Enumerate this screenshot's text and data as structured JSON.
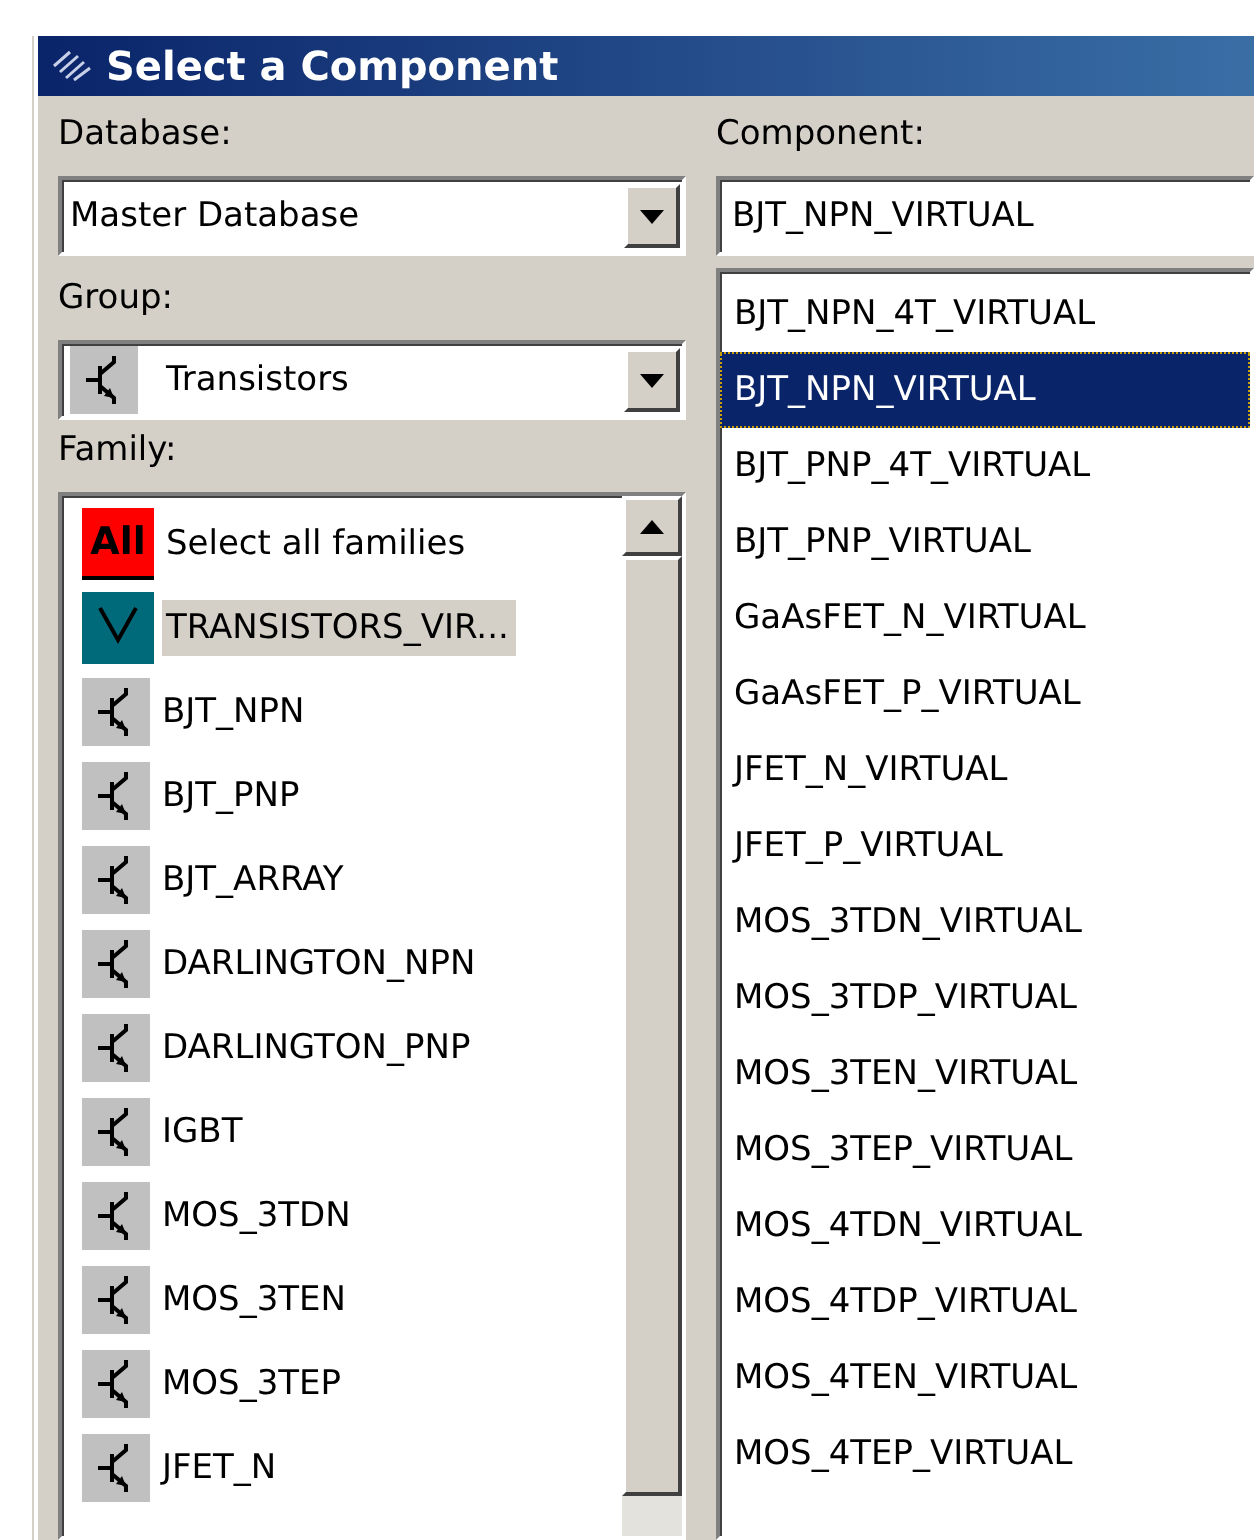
{
  "window": {
    "title": "Select a Component"
  },
  "database": {
    "label": "Database:",
    "value": "Master Database"
  },
  "group": {
    "label": "Group:",
    "value": "Transistors"
  },
  "family": {
    "label": "Family:",
    "items": [
      {
        "kind": "all",
        "badge": "All",
        "label": "Select all families",
        "selected": false
      },
      {
        "kind": "virtual",
        "label": "TRANSISTORS_VIR...",
        "selected": true
      },
      {
        "kind": "symbol",
        "label": "BJT_NPN",
        "selected": false
      },
      {
        "kind": "symbol",
        "label": "BJT_PNP",
        "selected": false
      },
      {
        "kind": "symbol",
        "label": "BJT_ARRAY",
        "selected": false
      },
      {
        "kind": "symbol",
        "label": "DARLINGTON_NPN",
        "selected": false
      },
      {
        "kind": "symbol",
        "label": "DARLINGTON_PNP",
        "selected": false
      },
      {
        "kind": "symbol",
        "label": "IGBT",
        "selected": false
      },
      {
        "kind": "symbol",
        "label": "MOS_3TDN",
        "selected": false
      },
      {
        "kind": "symbol",
        "label": "MOS_3TEN",
        "selected": false
      },
      {
        "kind": "symbol",
        "label": "MOS_3TEP",
        "selected": false
      },
      {
        "kind": "symbol",
        "label": "JFET_N",
        "selected": false
      }
    ]
  },
  "component": {
    "label": "Component:",
    "value": "BJT_NPN_VIRTUAL",
    "items": [
      {
        "label": "BJT_NPN_4T_VIRTUAL",
        "selected": false
      },
      {
        "label": "BJT_NPN_VIRTUAL",
        "selected": true
      },
      {
        "label": "BJT_PNP_4T_VIRTUAL",
        "selected": false
      },
      {
        "label": "BJT_PNP_VIRTUAL",
        "selected": false
      },
      {
        "label": "GaAsFET_N_VIRTUAL",
        "selected": false
      },
      {
        "label": "GaAsFET_P_VIRTUAL",
        "selected": false
      },
      {
        "label": "JFET_N_VIRTUAL",
        "selected": false
      },
      {
        "label": "JFET_P_VIRTUAL",
        "selected": false
      },
      {
        "label": "MOS_3TDN_VIRTUAL",
        "selected": false
      },
      {
        "label": "MOS_3TDP_VIRTUAL",
        "selected": false
      },
      {
        "label": "MOS_3TEN_VIRTUAL",
        "selected": false
      },
      {
        "label": "MOS_3TEP_VIRTUAL",
        "selected": false
      },
      {
        "label": "MOS_4TDN_VIRTUAL",
        "selected": false
      },
      {
        "label": "MOS_4TDP_VIRTUAL",
        "selected": false
      },
      {
        "label": "MOS_4TEN_VIRTUAL",
        "selected": false
      },
      {
        "label": "MOS_4TEP_VIRTUAL",
        "selected": false
      }
    ]
  }
}
